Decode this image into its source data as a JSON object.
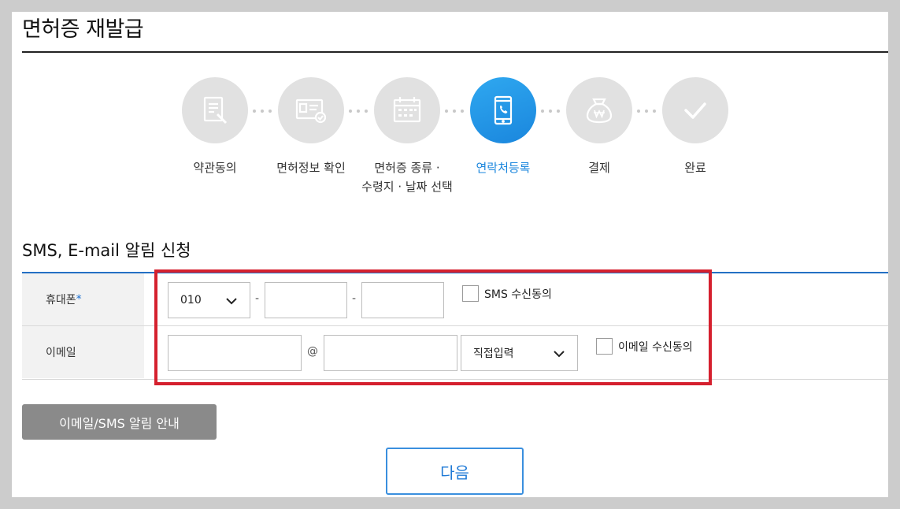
{
  "page": {
    "title": "면허증 재발급"
  },
  "steps": [
    {
      "label": "약관동의",
      "icon": "document-pen-icon",
      "active": false
    },
    {
      "label": "면허정보 확인",
      "icon": "id-card-check-icon",
      "active": false
    },
    {
      "label": "면허증 종류 ·",
      "label2": "수령지 · 날짜 선택",
      "icon": "calendar-icon",
      "active": false
    },
    {
      "label": "연락처등록",
      "icon": "phone-icon",
      "active": true
    },
    {
      "label": "결제",
      "icon": "money-bag-icon",
      "active": false
    },
    {
      "label": "완료",
      "icon": "checkmark-icon",
      "active": false
    }
  ],
  "section": {
    "title": "SMS, E-mail 알림 신청"
  },
  "form": {
    "phone": {
      "label": "휴대폰",
      "required_mark": "*",
      "prefix_value": "010",
      "dash": "-",
      "sms_consent_label": "SMS 수신동의"
    },
    "email": {
      "label": "이메일",
      "at": "@",
      "domain_select_value": "직접입력",
      "email_consent_label": "이메일 수신동의"
    }
  },
  "buttons": {
    "notice_label": "이메일/SMS 알림 안내",
    "next_label": "다음"
  },
  "colors": {
    "accent": "#1a86dd",
    "highlight_border": "#d5202e",
    "inactive_step": "#e1e1e1"
  }
}
